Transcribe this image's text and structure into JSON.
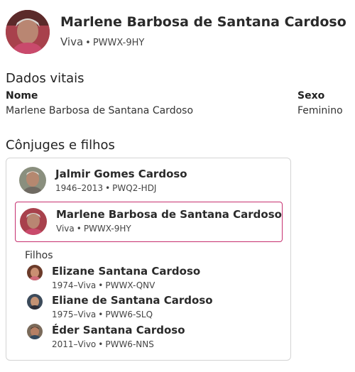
{
  "header": {
    "name": "Marlene Barbosa de Santana Cardoso",
    "status": "Viva",
    "separator": "•",
    "id": "PWWX-9HY"
  },
  "vitals": {
    "title": "Dados vitais",
    "name_label": "Nome",
    "name_value": "Marlene Barbosa de Santana Cardoso",
    "sex_label": "Sexo",
    "sex_value": "Feminino"
  },
  "family": {
    "title": "Cônjuges e filhos",
    "spouse": {
      "name": "Jalmir Gomes Cardoso",
      "years": "1946–2013",
      "id": "PWQ2-HDJ"
    },
    "self": {
      "name": "Marlene Barbosa de Santana Cardoso",
      "years": "Viva",
      "id": "PWWX-9HY"
    },
    "children_label": "Filhos",
    "children": [
      {
        "name": "Elizane Santana Cardoso",
        "years": "1974–Viva",
        "id": "PWWX-QNV"
      },
      {
        "name": "Eliane de Santana Cardoso",
        "years": "1975–Viva",
        "id": "PWW6-SLQ"
      },
      {
        "name": "Éder Santana Cardoso",
        "years": "2011–Vivo",
        "id": "PWW6-NNS"
      }
    ]
  },
  "colors": {
    "selected_border": "#c6306f",
    "card_border": "#d4d4d4"
  },
  "icons": {
    "portrait": "person-photo"
  }
}
